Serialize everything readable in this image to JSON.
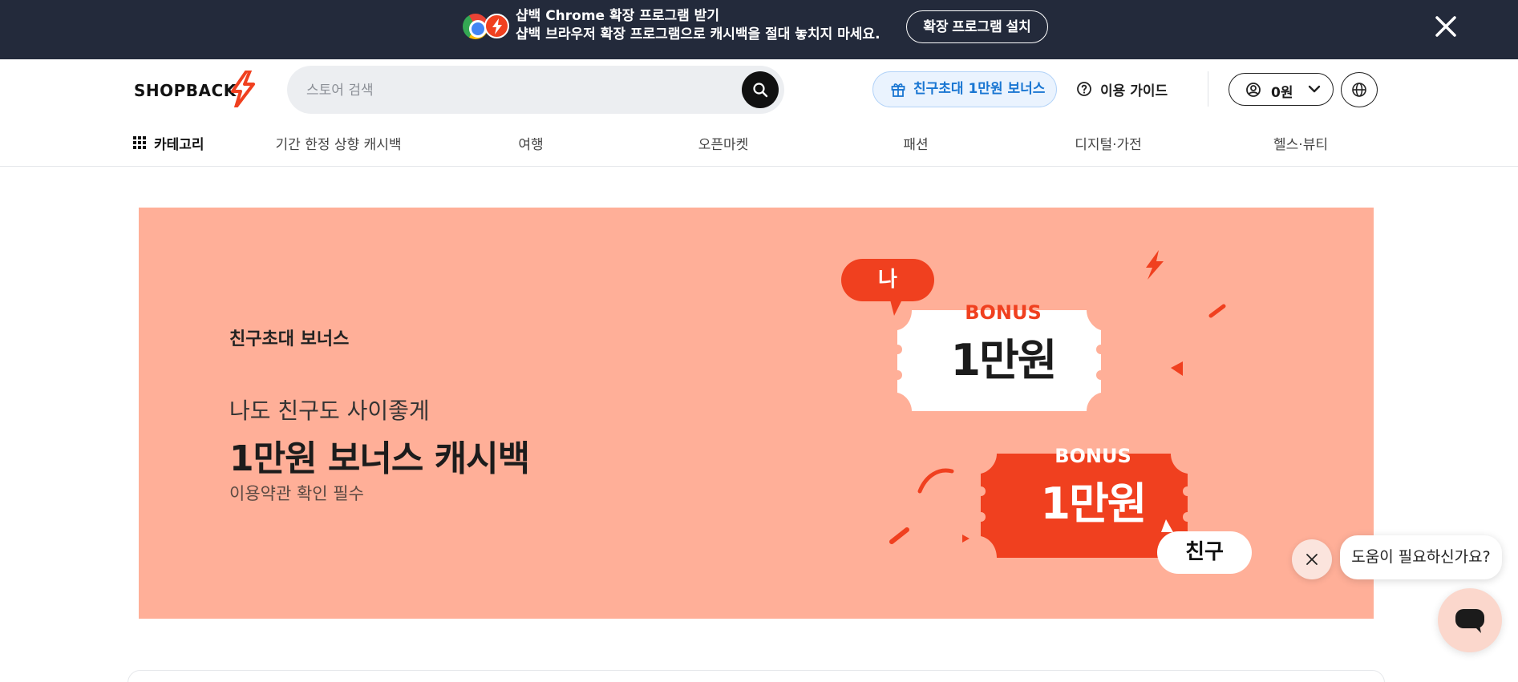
{
  "extension_bar": {
    "title": "샵백 Chrome 확장 프로그램 받기",
    "subtitle": "샵백 브라우저 확장 프로그램으로 캐시백을 절대 놓치지 마세요.",
    "install_label": "확장 프로그램 설치",
    "icons": [
      "chrome-logo",
      "shopback-logo",
      "close-icon"
    ]
  },
  "header": {
    "logo_text": "SHOPBACK",
    "search": {
      "placeholder": "스토어 검색",
      "value": ""
    },
    "invite_label": "친구초대 1만원 보너스",
    "guide_label": "이용 가이드",
    "wallet_label": "0원",
    "icons": [
      "gift-icon",
      "question-icon",
      "user-icon",
      "chevron-down-icon",
      "globe-icon",
      "search-icon"
    ]
  },
  "nav": {
    "category_label": "카테고리",
    "items": [
      {
        "label": "기간 한정 상향 캐시백"
      },
      {
        "label": "여행"
      },
      {
        "label": "오픈마켓"
      },
      {
        "label": "패션"
      },
      {
        "label": "디지털·가전"
      },
      {
        "label": "헬스·뷰티"
      }
    ]
  },
  "hero": {
    "eyebrow": "친구초대 보너스",
    "line1": "나도 친구도 사이좋게",
    "line2": "1만원 보너스 캐시백",
    "note": "이용약관 확인 필수",
    "tag_me": "나",
    "tag_friend": "친구",
    "ticket1": {
      "bonus": "BONUS",
      "amount": "1만원"
    },
    "ticket2": {
      "bonus": "BONUS",
      "amount": "1만원"
    },
    "colors": {
      "background": "#ffaf98",
      "accent": "#f0401f"
    }
  },
  "help_widget": {
    "bubble_text": "도움이 필요하신가요?",
    "icons": [
      "close-icon",
      "chat-icon"
    ]
  }
}
